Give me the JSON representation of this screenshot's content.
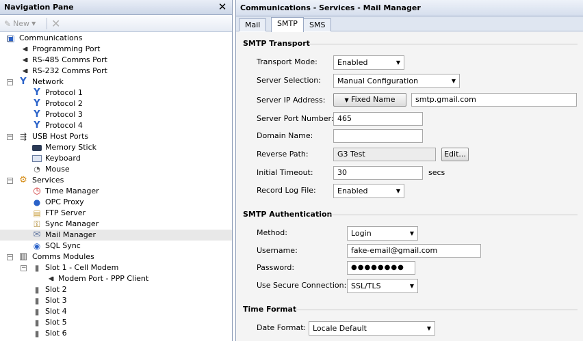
{
  "nav": {
    "title": "Navigation Pane",
    "toolbar": {
      "new_label": "New"
    },
    "items": [
      {
        "label": "Communications",
        "icon": "communications-icon"
      },
      {
        "label": "Programming Port",
        "icon": "serial-port-icon"
      },
      {
        "label": "RS-485 Comms Port",
        "icon": "serial-port-icon"
      },
      {
        "label": "RS-232 Comms Port",
        "icon": "serial-port-icon"
      },
      {
        "label": "Network",
        "icon": "network-icon"
      },
      {
        "label": "Protocol 1",
        "icon": "protocol-icon"
      },
      {
        "label": "Protocol 2",
        "icon": "protocol-icon"
      },
      {
        "label": "Protocol 3",
        "icon": "protocol-icon"
      },
      {
        "label": "Protocol 4",
        "icon": "protocol-icon"
      },
      {
        "label": "USB Host Ports",
        "icon": "usb-icon"
      },
      {
        "label": "Memory Stick",
        "icon": "memory-stick-icon"
      },
      {
        "label": "Keyboard",
        "icon": "keyboard-icon"
      },
      {
        "label": "Mouse",
        "icon": "mouse-icon"
      },
      {
        "label": "Services",
        "icon": "services-icon"
      },
      {
        "label": "Time Manager",
        "icon": "clock-icon"
      },
      {
        "label": "OPC Proxy",
        "icon": "opc-icon"
      },
      {
        "label": "FTP Server",
        "icon": "ftp-icon"
      },
      {
        "label": "Sync Manager",
        "icon": "sync-icon"
      },
      {
        "label": "Mail Manager",
        "icon": "mail-icon"
      },
      {
        "label": "SQL Sync",
        "icon": "sql-icon"
      },
      {
        "label": "Comms Modules",
        "icon": "modules-icon"
      },
      {
        "label": "Slot 1 - Cell Modem",
        "icon": "slot-icon"
      },
      {
        "label": "Modem Port - PPP Client",
        "icon": "serial-port-icon"
      },
      {
        "label": "Slot 2",
        "icon": "slot-icon"
      },
      {
        "label": "Slot 3",
        "icon": "slot-icon"
      },
      {
        "label": "Slot 4",
        "icon": "slot-icon"
      },
      {
        "label": "Slot 5",
        "icon": "slot-icon"
      },
      {
        "label": "Slot 6",
        "icon": "slot-icon"
      }
    ]
  },
  "content": {
    "title": "Communications - Services - Mail Manager",
    "tabs": [
      "Mail",
      "SMTP",
      "SMS"
    ],
    "active_tab": "SMTP",
    "smtp_transport": {
      "heading": "SMTP Transport",
      "transport_mode": {
        "label": "Transport Mode:",
        "value": "Enabled"
      },
      "server_selection": {
        "label": "Server Selection:",
        "value": "Manual Configuration"
      },
      "server_ip": {
        "label": "Server IP Address:",
        "mode_button": "Fixed Name",
        "value": "smtp.gmail.com"
      },
      "server_port": {
        "label": "Server Port Number:",
        "value": "465"
      },
      "domain_name": {
        "label": "Domain Name:",
        "value": ""
      },
      "reverse_path": {
        "label": "Reverse Path:",
        "value": "G3 Test",
        "edit_button": "Edit..."
      },
      "initial_timeout": {
        "label": "Initial Timeout:",
        "value": "30",
        "unit": "secs"
      },
      "record_log": {
        "label": "Record Log File:",
        "value": "Enabled"
      }
    },
    "smtp_auth": {
      "heading": "SMTP Authentication",
      "method": {
        "label": "Method:",
        "value": "Login"
      },
      "username": {
        "label": "Username:",
        "value": "fake-email@gmail.com"
      },
      "password": {
        "label": "Password:",
        "value": "●●●●●●●●"
      },
      "secure": {
        "label": "Use Secure Connection:",
        "value": "SSL/TLS"
      }
    },
    "time_format": {
      "heading": "Time Format",
      "date_format": {
        "label": "Date Format:",
        "value": "Locale Default"
      }
    }
  }
}
